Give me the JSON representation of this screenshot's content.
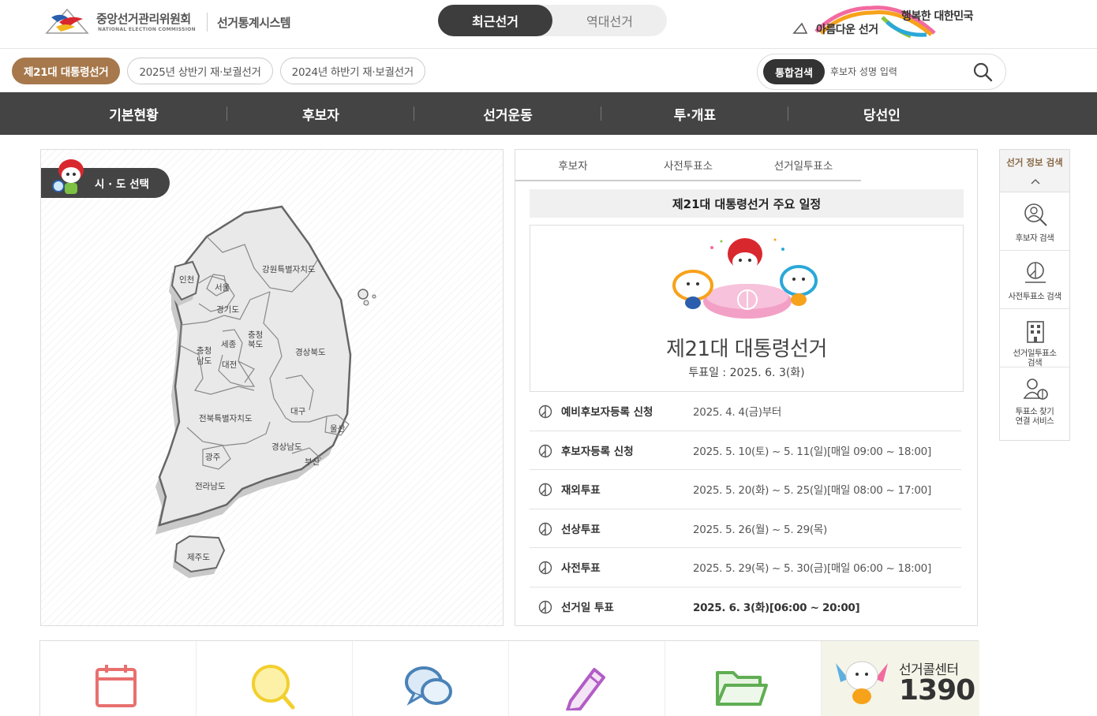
{
  "header": {
    "org_name": "중앙선거관리위원회",
    "org_name_en": "NATIONAL ELECTION COMMISSION",
    "system_name": "선거통계시스템",
    "toggle": {
      "recent": "최근선거",
      "past": "역대선거"
    },
    "slogan_line1": "행복한 대한민국",
    "slogan_line2": "아름다운 선거"
  },
  "elections": [
    {
      "label": "제21대 대통령선거",
      "active": true
    },
    {
      "label": "2025년 상반기 재·보궐선거",
      "active": false
    },
    {
      "label": "2024년 하반기 재·보궐선거",
      "active": false
    }
  ],
  "search": {
    "tag": "통합검색",
    "placeholder": "후보자 성명 입력"
  },
  "nav": [
    "기본현황",
    "후보자",
    "선거운동",
    "투·개표",
    "당선인"
  ],
  "map": {
    "tab_label": "시 · 도 선택",
    "regions": {
      "incheon": "인천",
      "seoul": "서울",
      "gyeonggi": "경기도",
      "gangwon": "강원특별자치도",
      "chungnam_1": "충청",
      "chungnam_2": "남도",
      "sejong": "세종",
      "daejeon": "대전",
      "chungbuk_1": "충청",
      "chungbuk_2": "북도",
      "gyeongbuk": "경상북도",
      "daegu": "대구",
      "ulsan": "울산",
      "jeonbuk": "전북특별자치도",
      "gyeongnam": "경상남도",
      "busan": "부산",
      "gwangju": "광주",
      "jeonnam": "전라남도",
      "jeju": "제주도"
    }
  },
  "schedule": {
    "tabs": [
      "후보자",
      "사전투표소",
      "선거일투표소"
    ],
    "title": "제21대 대통령선거 주요 일정",
    "poster_title": "제21대 대통령선거",
    "poster_date": "투표일 : 2025. 6. 3(화)",
    "rows": [
      {
        "name": "예비후보자등록 신청",
        "date": "2025. 4. 4(금)부터"
      },
      {
        "name": "후보자등록 신청",
        "date": "2025. 5. 10(토) ~ 5. 11(일)[매일 09:00 ~ 18:00]"
      },
      {
        "name": "재외투표",
        "date": "2025. 5. 20(화) ~ 5. 25(일)[매일 08:00 ~ 17:00]"
      },
      {
        "name": "선상투표",
        "date": "2025. 5. 26(월) ~ 5. 29(목)"
      },
      {
        "name": "사전투표",
        "date": "2025. 5. 29(목) ~ 5. 30(금)[매일 06:00 ~ 18:00]"
      },
      {
        "name": "선거일 투표",
        "date": "2025. 6. 3(화)[06:00 ~ 20:00]"
      }
    ]
  },
  "side_menu": {
    "title": "선거 정보 검색",
    "items": [
      {
        "label": "후보자 검색",
        "icon": "person-search-icon"
      },
      {
        "label": "사전투표소 검색",
        "icon": "polling-place-icon"
      },
      {
        "label": "선거일투표소\n검색",
        "icon": "building-icon"
      },
      {
        "label": "투표소 찾기\n연결 서비스",
        "icon": "people-icon"
      }
    ]
  },
  "bottom_links": {
    "icons": [
      "calendar-icon",
      "search-icon",
      "chat-icon",
      "pencil-icon",
      "folder-icon"
    ],
    "call_center_label": "선거콜센터",
    "call_center_number": "1390"
  },
  "colors": {
    "accent_brown": "#a7784b",
    "nav_dark": "#444444"
  }
}
